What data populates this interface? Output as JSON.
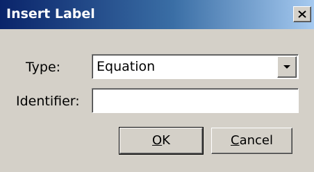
{
  "window": {
    "title": "Insert Label",
    "close_icon": "close-icon"
  },
  "form": {
    "type_label": "Type:",
    "type_value": "Equation",
    "dropdown_icon": "chevron-down-icon",
    "identifier_label": "Identifier:",
    "identifier_value": ""
  },
  "buttons": {
    "ok": {
      "mnemonic": "O",
      "rest": "K"
    },
    "cancel": {
      "mnemonic": "C",
      "rest": "ancel"
    }
  },
  "colors": {
    "face": "#d4d0c8",
    "title_start": "#0a246a",
    "title_end": "#a6caf0"
  }
}
